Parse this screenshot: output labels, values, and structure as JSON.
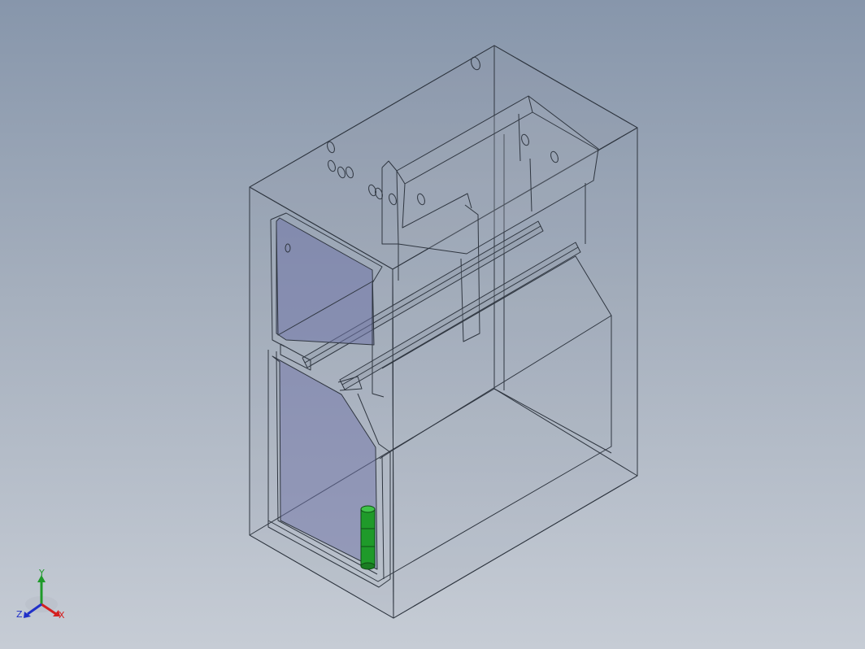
{
  "viewport": {
    "background_top": "#8796ab",
    "background_bottom": "#c6ccd5"
  },
  "model": {
    "wireframe_color": "#2f3640",
    "shell_fill": "#8e97a4",
    "panel_fill": "#6f74a8",
    "pin_color": "#1f9a2a"
  },
  "triad": {
    "x_label": "X",
    "y_label": "Y",
    "z_label": "Z",
    "x_color": "#d42020",
    "y_color": "#1f9a2a",
    "z_color": "#2030c8"
  }
}
